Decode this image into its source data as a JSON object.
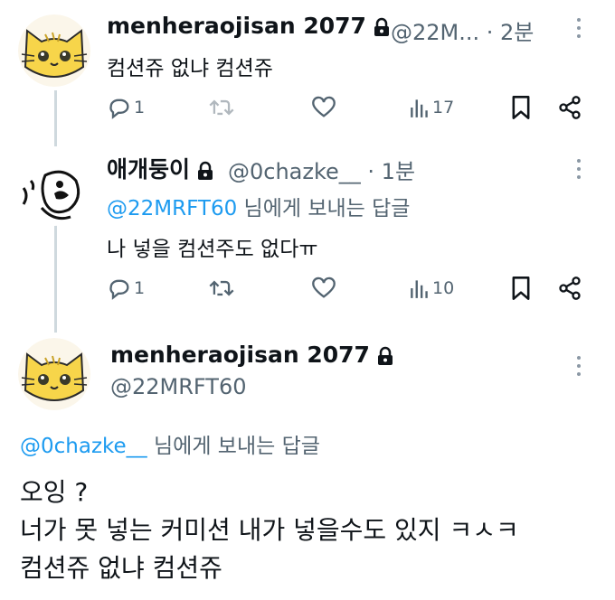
{
  "tweet1": {
    "author_name": "menheraojisan 2077",
    "handle_time": "@22M... · 2분",
    "text": "컴션쥬 없냐 컴션쥬",
    "reply_count": "1",
    "view_count": "17"
  },
  "tweet2": {
    "author_name": "애개둥이",
    "handle_time": "@0chazke__ · 1분",
    "replying_mention": "@22MRFT60",
    "replying_suffix": " 님에게 보내는 답글",
    "text": "나 넣을 컴션주도 없다ㅠ",
    "reply_count": "1",
    "view_count": "10"
  },
  "main_tweet": {
    "author_name": "menheraojisan 2077",
    "handle": "@22MRFT60",
    "replying_mention": "@0chazke__",
    "replying_suffix": " 님에게 보내는 답글",
    "lines": [
      "오잉 ?",
      "너가 못 넣는 커미션 내가 넣을수도 있지 ㅋㅅㅋ",
      "컴션쥬 없냐 컴션쥬"
    ]
  },
  "colors": {
    "accent": "#1d9bf0",
    "muted": "#536471",
    "thread_line": "#cfd9de"
  }
}
